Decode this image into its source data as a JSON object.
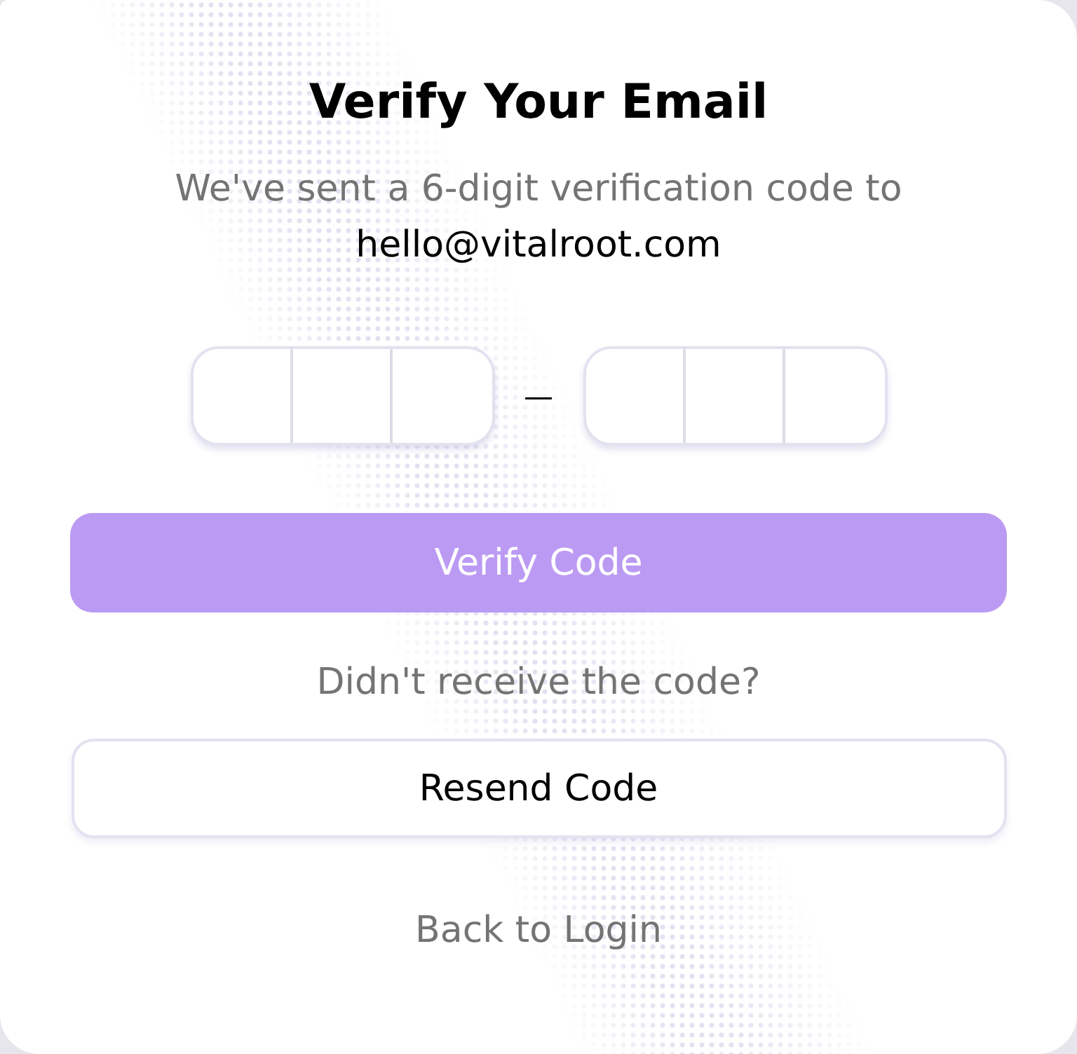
{
  "title": "Verify Your Email",
  "subtitle": "We've sent a 6-digit verification code to",
  "email": "hello@vitalroot.com",
  "code_groups": [
    {
      "cells": [
        {
          "focused": false
        },
        {
          "focused": false
        },
        {
          "focused": false
        }
      ]
    },
    {
      "cells": [
        {
          "focused": false
        },
        {
          "focused": false
        },
        {
          "focused": false
        }
      ]
    }
  ],
  "code_separator": "—",
  "verify_button": {
    "label": "Verify Code",
    "disabled": true
  },
  "resend_prompt": "Didn't receive the code?",
  "resend_button": {
    "label": "Resend Code"
  },
  "back_link": "Back to Login"
}
